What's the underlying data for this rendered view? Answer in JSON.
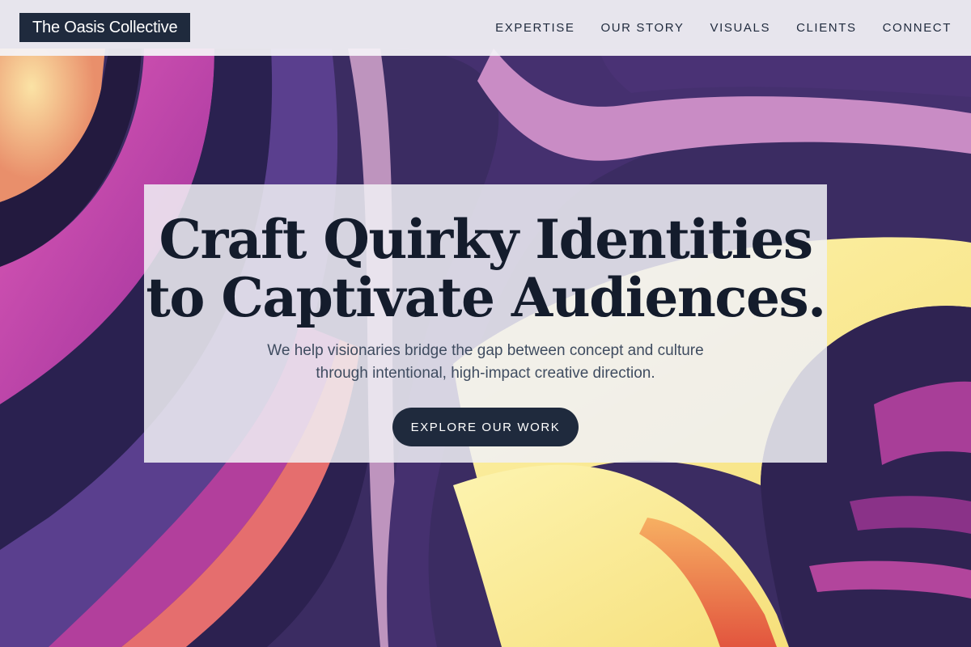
{
  "brand": {
    "name": "The Oasis Collective"
  },
  "nav": {
    "items": [
      "EXPERTISE",
      "OUR STORY",
      "VISUALS",
      "CLIENTS",
      "CONNECT"
    ]
  },
  "hero": {
    "title_line1": "Craft Quirky Identities",
    "title_line2": "to Captivate Audiences.",
    "subtitle_line1": "We help visionaries bridge the gap between concept and culture",
    "subtitle_line2": "through intentional, high-impact creative direction.",
    "cta_label": "EXPLORE OUR WORK",
    "background": "abstract-swirl-artwork"
  },
  "colors": {
    "navy": "#1f2a3d",
    "title": "#141c2c",
    "magenta": "#c84aa6",
    "purple": "#3d2f6b",
    "yellow": "#fbeb95",
    "orange": "#f08a4a"
  }
}
